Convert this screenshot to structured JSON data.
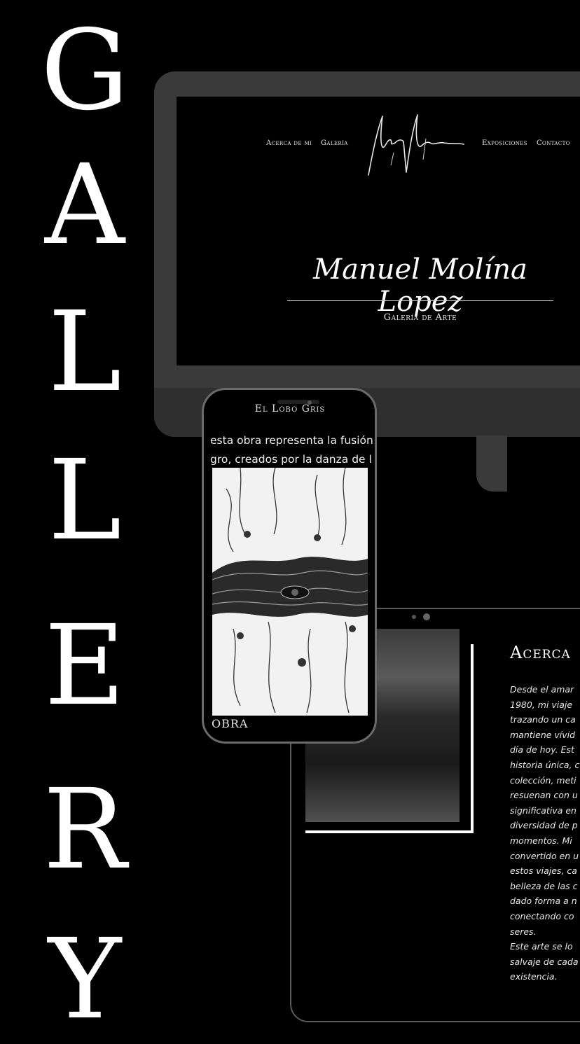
{
  "side_title": [
    "G",
    "A",
    "L",
    "L",
    "E",
    "R",
    "Y"
  ],
  "desktop": {
    "nav_left": [
      "Acerca de mi",
      "Galería"
    ],
    "nav_right": [
      "Exposiciones",
      "Contacto"
    ],
    "hero_title": "Manuel Molína Lopez",
    "hero_subtitle": "Galería de Arte"
  },
  "phone": {
    "title": "El Lobo Gris",
    "text_line_1": "esta obra representa la fusión",
    "text_line_2": "gro, creados por la danza de l",
    "footer": "OBRA"
  },
  "tablet": {
    "heading": "Acerca",
    "body_lines": [
      "Desde el amar",
      "1980, mi viaje",
      "trazando un ca",
      "mantiene vívid",
      "día de hoy. Est",
      "historia única, c",
      "colección, meti",
      "resuenan con u",
      "significativa en",
      "diversidad de p",
      "momentos. Mi",
      "convertido en u",
      "estos viajes, ca",
      "belleza de las c",
      "dado forma a n",
      "conectando co",
      "seres.",
      "Este arte se lo",
      "salvaje de cada",
      "existencia."
    ]
  }
}
